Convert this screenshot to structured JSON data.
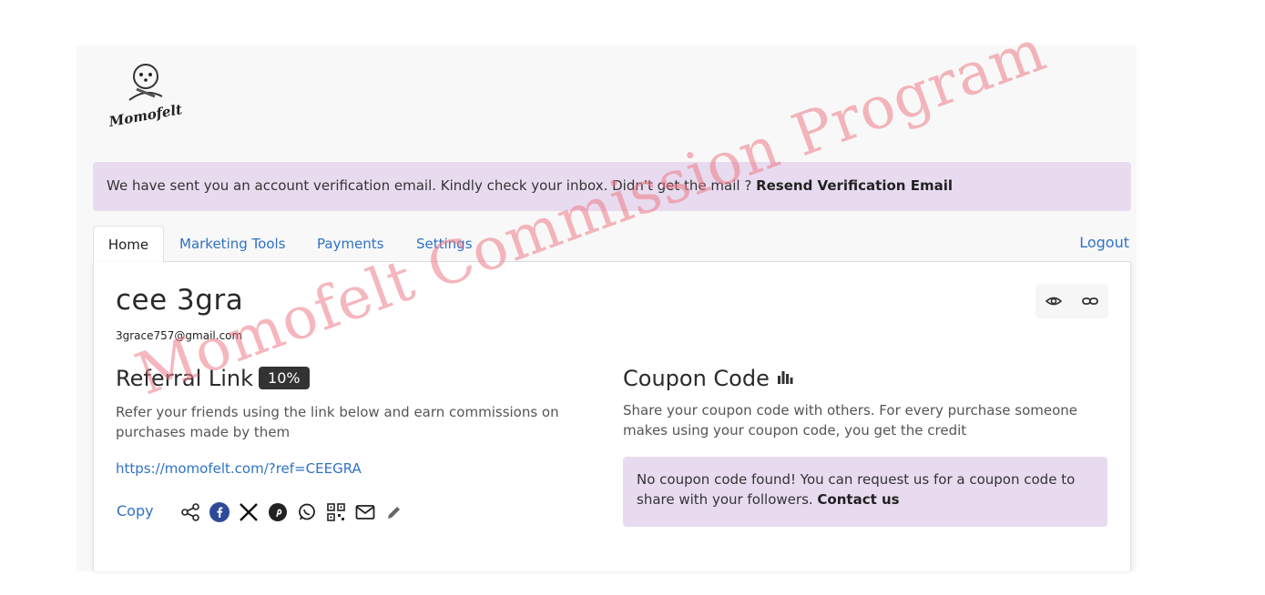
{
  "brand": {
    "logo_text": "Momofelt"
  },
  "alert": {
    "message": "We have sent you an account verification email. Kindly check your inbox. Didn't get the mail ? ",
    "action_label": "Resend Verification Email"
  },
  "tabs": [
    {
      "label": "Home",
      "active": true
    },
    {
      "label": "Marketing Tools",
      "active": false
    },
    {
      "label": "Payments",
      "active": false
    },
    {
      "label": "Settings",
      "active": false
    }
  ],
  "logout_label": "Logout",
  "profile": {
    "name": "cee 3gra",
    "email": "3grace757@gmail.com"
  },
  "top_icons": [
    "eye-icon",
    "link-icon"
  ],
  "referral": {
    "title": "Referral Link",
    "commission": "10%",
    "description": "Refer your friends using the link below and earn commissions on purchases made by them",
    "url": "https://momofelt.com/?ref=CEEGRA",
    "copy_label": "Copy",
    "share_icons": [
      "share-icon",
      "facebook-icon",
      "x-icon",
      "pinterest-icon",
      "whatsapp-icon",
      "qr-code-icon",
      "email-icon",
      "edit-icon"
    ]
  },
  "coupon": {
    "title": "Coupon Code",
    "description": "Share your coupon code with others. For every purchase someone makes using your coupon code, you get the credit",
    "empty_message": "No coupon code found! You can request us for a coupon code to share with your followers. ",
    "contact_label": "Contact us"
  },
  "watermark": "Momofelt Commission Program",
  "colors": {
    "accent": "#2f72c6",
    "alert_bg": "#e8dbf0",
    "badge_bg": "#333333",
    "watermark": "#ec7a86"
  }
}
